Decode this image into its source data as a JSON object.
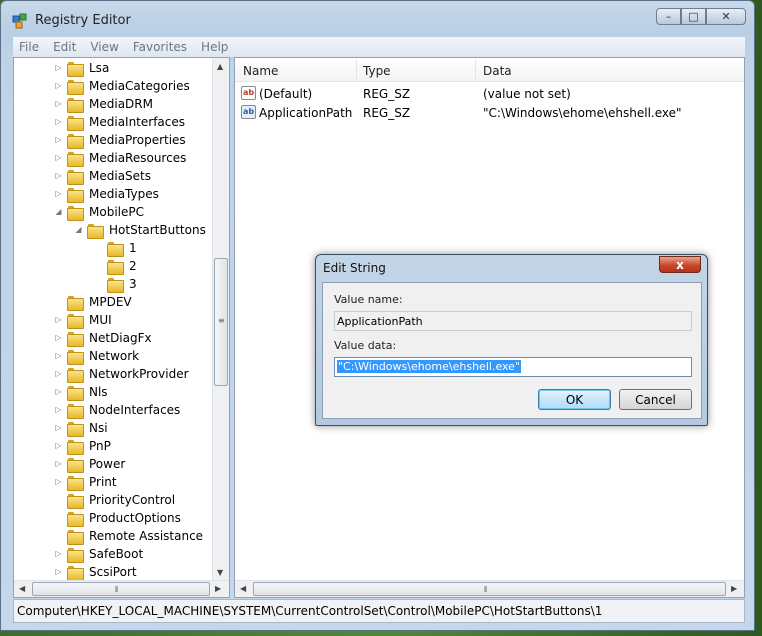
{
  "window": {
    "title": "Registry Editor",
    "caption_buttons": {
      "minimize": "–",
      "maximize": "□",
      "close": "✕"
    }
  },
  "menu": [
    "File",
    "Edit",
    "View",
    "Favorites",
    "Help"
  ],
  "tree": {
    "items": [
      {
        "label": "Lsa",
        "level": 0,
        "expander": "collapsed"
      },
      {
        "label": "MediaCategories",
        "level": 0,
        "expander": "collapsed"
      },
      {
        "label": "MediaDRM",
        "level": 0,
        "expander": "collapsed"
      },
      {
        "label": "MediaInterfaces",
        "level": 0,
        "expander": "collapsed"
      },
      {
        "label": "MediaProperties",
        "level": 0,
        "expander": "collapsed"
      },
      {
        "label": "MediaResources",
        "level": 0,
        "expander": "collapsed"
      },
      {
        "label": "MediaSets",
        "level": 0,
        "expander": "collapsed"
      },
      {
        "label": "MediaTypes",
        "level": 0,
        "expander": "collapsed"
      },
      {
        "label": "MobilePC",
        "level": 0,
        "expander": "expanded"
      },
      {
        "label": "HotStartButtons",
        "level": 1,
        "expander": "expanded"
      },
      {
        "label": "1",
        "level": 2,
        "expander": "none"
      },
      {
        "label": "2",
        "level": 2,
        "expander": "none"
      },
      {
        "label": "3",
        "level": 2,
        "expander": "none"
      },
      {
        "label": "MPDEV",
        "level": 0,
        "expander": "none"
      },
      {
        "label": "MUI",
        "level": 0,
        "expander": "collapsed"
      },
      {
        "label": "NetDiagFx",
        "level": 0,
        "expander": "collapsed"
      },
      {
        "label": "Network",
        "level": 0,
        "expander": "collapsed"
      },
      {
        "label": "NetworkProvider",
        "level": 0,
        "expander": "collapsed"
      },
      {
        "label": "Nls",
        "level": 0,
        "expander": "collapsed"
      },
      {
        "label": "NodeInterfaces",
        "level": 0,
        "expander": "collapsed"
      },
      {
        "label": "Nsi",
        "level": 0,
        "expander": "collapsed"
      },
      {
        "label": "PnP",
        "level": 0,
        "expander": "collapsed"
      },
      {
        "label": "Power",
        "level": 0,
        "expander": "collapsed"
      },
      {
        "label": "Print",
        "level": 0,
        "expander": "collapsed"
      },
      {
        "label": "PriorityControl",
        "level": 0,
        "expander": "none"
      },
      {
        "label": "ProductOptions",
        "level": 0,
        "expander": "none"
      },
      {
        "label": "Remote Assistance",
        "level": 0,
        "expander": "none"
      },
      {
        "label": "SafeBoot",
        "level": 0,
        "expander": "collapsed"
      },
      {
        "label": "ScsiPort",
        "level": 0,
        "expander": "collapsed"
      }
    ]
  },
  "values_list": {
    "columns": [
      "Name",
      "Type",
      "Data"
    ],
    "rows": [
      {
        "icon": "string-value-icon",
        "name": "(Default)",
        "type": "REG_SZ",
        "data": "(value not set)"
      },
      {
        "icon": "string-value-icon",
        "name": "ApplicationPath",
        "type": "REG_SZ",
        "data": "\"C:\\Windows\\ehome\\ehshell.exe\""
      }
    ]
  },
  "status_bar": {
    "path": "Computer\\HKEY_LOCAL_MACHINE\\SYSTEM\\CurrentControlSet\\Control\\MobilePC\\HotStartButtons\\1"
  },
  "dialog": {
    "title": "Edit String",
    "close_label": "x",
    "value_name_label": "Value name:",
    "value_name": "ApplicationPath",
    "value_data_label": "Value data:",
    "value_data": "\"C:\\Windows\\ehome\\ehshell.exe\"",
    "ok_label": "OK",
    "cancel_label": "Cancel"
  }
}
